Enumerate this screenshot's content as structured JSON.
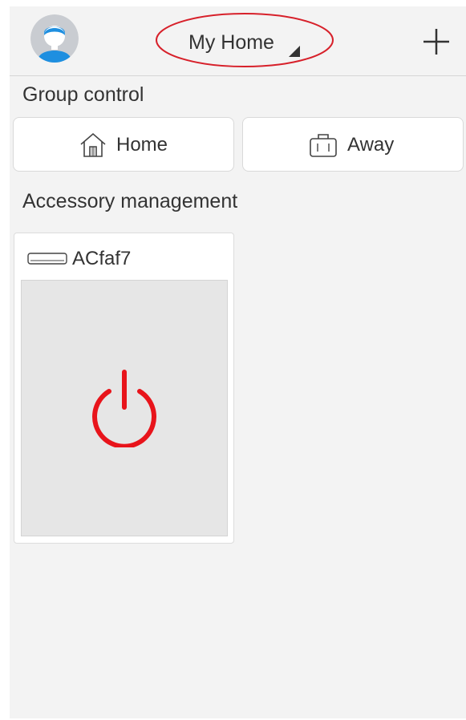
{
  "header": {
    "title": "My Home",
    "avatar_icon": "user-avatar-icon",
    "add_icon": "plus-icon",
    "highlight_color": "#d7202a"
  },
  "group_control": {
    "label": "Group control",
    "buttons": [
      {
        "label": "Home",
        "icon": "house-icon"
      },
      {
        "label": "Away",
        "icon": "suitcase-icon"
      }
    ]
  },
  "accessories": {
    "label": "Accessory management",
    "items": [
      {
        "name": "ACfaf7",
        "icon": "air-conditioner-icon",
        "power_icon": "power-icon",
        "power_color": "#e8141b"
      }
    ]
  },
  "colors": {
    "background": "#f3f3f3",
    "avatar_blue": "#1e8fe0",
    "avatar_bg": "#c9ccd1",
    "power_red": "#e8141b"
  }
}
